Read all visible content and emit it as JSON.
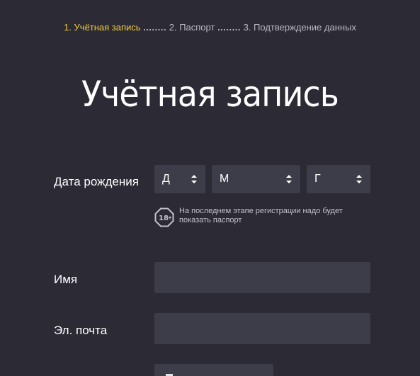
{
  "stepper": {
    "step1": "1. Учётная запись",
    "sep1": "........",
    "step2": "2. Паспорт",
    "sep2": "........",
    "step3": "3. Подтверждение данных"
  },
  "page_title": "Учётная запись",
  "birthdate": {
    "label": "Дата рождения",
    "day_placeholder": "Д",
    "month_placeholder": "М",
    "year_placeholder": "Г"
  },
  "age_notice": {
    "badge_icon": "age-18-plus-icon",
    "text_line1": "На последнем этапе регистрации надо будет",
    "text_line2": "показать паспорт"
  },
  "name_field": {
    "label": "Имя",
    "value": ""
  },
  "email_field": {
    "label": "Эл. почта",
    "value": ""
  },
  "colors": {
    "background": "#2b2a35",
    "field": "#3d3c49",
    "active_step": "#f2cd3d",
    "muted_text": "#b9b8c2"
  }
}
